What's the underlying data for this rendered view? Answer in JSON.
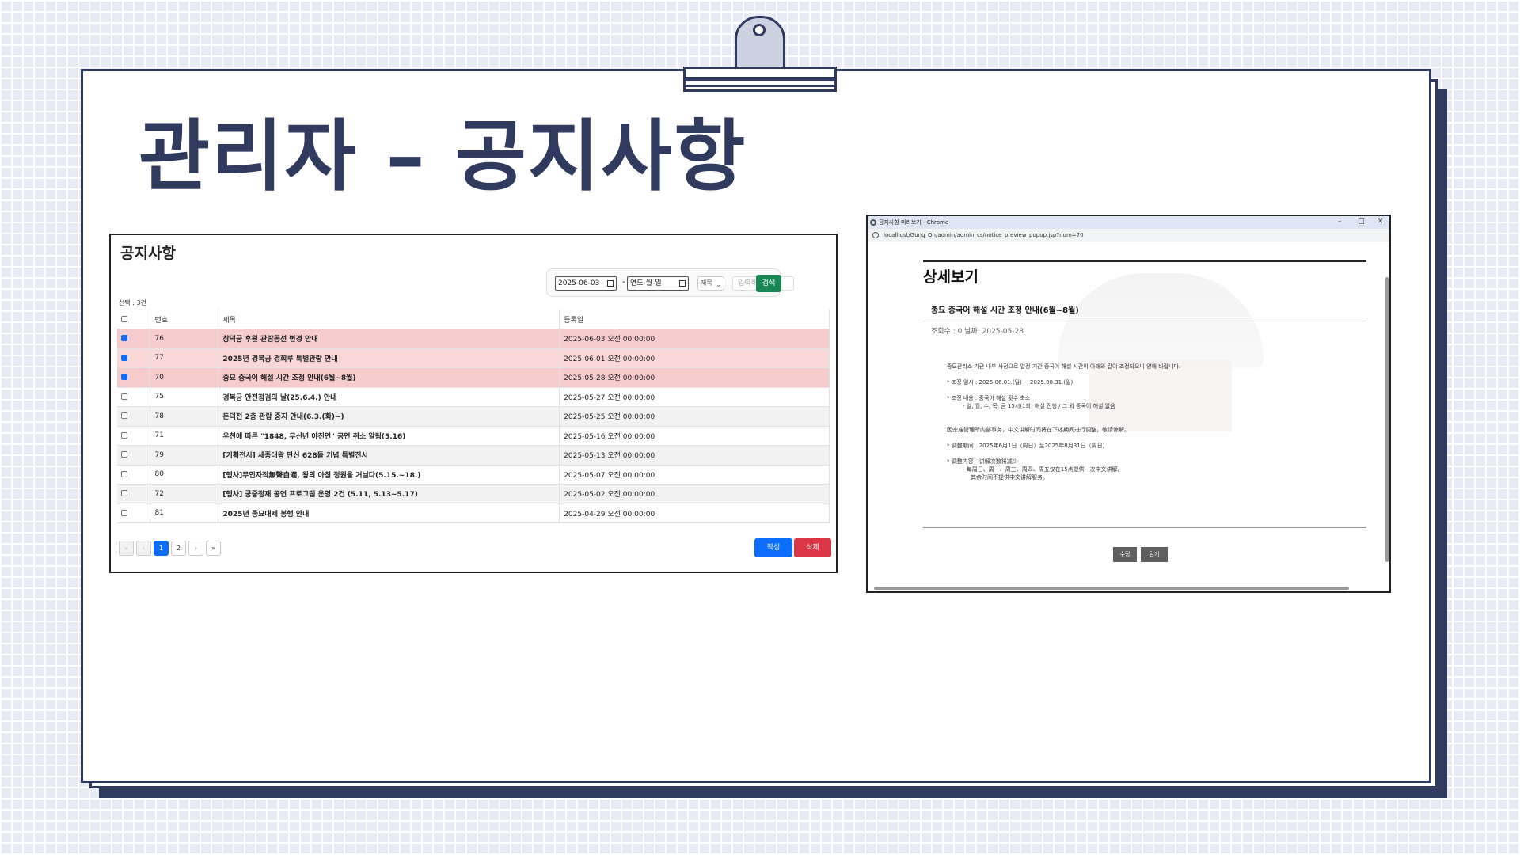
{
  "slide": {
    "title": "관리자 – 공지사항"
  },
  "list": {
    "heading": "공지사항",
    "search": {
      "start_date": "2025-06-03",
      "end_date": "연도-월-일",
      "dash": "-",
      "field": "제목",
      "keyword_placeholder": "입력해주세요",
      "button": "검색"
    },
    "selected_count": "선택 : 3건",
    "columns": [
      "번호",
      "제목",
      "등록일"
    ],
    "rows": [
      {
        "checked": true,
        "no": "76",
        "title": "창덕궁 후원 관람동선 변경 안내",
        "date": "2025-06-03 오전 00:00:00"
      },
      {
        "checked": true,
        "no": "77",
        "title": "2025년 경복궁 경회루 특별관람 안내",
        "date": "2025-06-01 오전 00:00:00"
      },
      {
        "checked": true,
        "no": "70",
        "title": "종묘 중국어 해설 시간 조정 안내(6월~8월)",
        "date": "2025-05-28 오전 00:00:00"
      },
      {
        "checked": false,
        "no": "75",
        "title": "경복궁 안전점검의 날(25.6.4.) 안내",
        "date": "2025-05-27 오전 00:00:00"
      },
      {
        "checked": false,
        "no": "78",
        "title": "돈덕전 2층 관람 중지 안내(6.3.(화)~)",
        "date": "2025-05-25 오전 00:00:00"
      },
      {
        "checked": false,
        "no": "71",
        "title": "우천에 따른 \"1848, 무신년 야진연\" 공연 취소 알림(5.16)",
        "date": "2025-05-16 오전 00:00:00"
      },
      {
        "checked": false,
        "no": "79",
        "title": "[기획전시] 세종대왕 탄신 628돌 기념 특별전시",
        "date": "2025-05-13 오전 00:00:00"
      },
      {
        "checked": false,
        "no": "80",
        "title": "[행사]무언자적無聲自適, 왕의 아침 정원을 거닐다(5.15.~18.)",
        "date": "2025-05-07 오전 00:00:00"
      },
      {
        "checked": false,
        "no": "72",
        "title": "[행사] 궁중정재 공연 프로그램 운영 2건 (5.11, 5.13~5.17)",
        "date": "2025-05-02 오전 00:00:00"
      },
      {
        "checked": false,
        "no": "81",
        "title": "2025년 종묘대제 봉행 안내",
        "date": "2025-04-29 오전 00:00:00"
      }
    ],
    "pager": {
      "first": "«",
      "prev": "‹",
      "pages": [
        "1",
        "2"
      ],
      "current": "1",
      "next": "›",
      "last": "»"
    },
    "buttons": {
      "write": "작성",
      "delete": "삭제"
    }
  },
  "popup": {
    "window_title": "공지사항 미리보기 - Chrome",
    "url": "localhost/Gung_On/admin/admin_cs/notice_preview_popup.jsp?num=70",
    "controls": {
      "minimize": "–",
      "maximize": "□",
      "close": "✕"
    },
    "heading": "상세보기",
    "subject": "종묘 중국어 해설 시간 조정 안내(6월~8월)",
    "meta": "조회수 : 0  날짜: 2025-05-28",
    "body": [
      "종묘관리소 기관 내부 사정으로 일정 기간 중국어 해설 시간이 아래와 같이 조정되오니 양해 바랍니다.",
      "",
      "* 조정 일시 : 2025.06.01.(일) ~ 2025.08.31.(일)",
      "",
      "* 조정 내용 : 중국어 해설 횟수 축소",
      "    - 일, 월, 수, 목, 금 15시(1회) 해설 진행 / 그 외 중국어 해설 없음",
      "",
      "",
      "因宗庙管理所内部事务，中文讲解时间将在下述期间进行调整，敬请谅解。",
      "",
      "* 调整期间：2025年6月1日（周日）至2025年8月31日（周日）",
      "",
      "* 调整内容：讲解次数将减少",
      "    - 每周日、周一、周三、周四、周五仅在15点提供一次中文讲解。",
      "      其余时间不提供中文讲解服务。"
    ],
    "buttons": {
      "edit": "수정",
      "close": "닫기"
    }
  }
}
